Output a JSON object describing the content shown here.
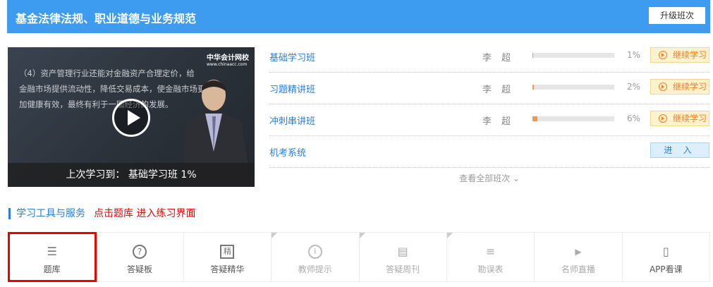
{
  "header": {
    "title": "基金法律法规、职业道德与业务规范",
    "upgrade_label": "升级班次"
  },
  "video": {
    "slide_lines": [
      "（4）资产管理行业还能对金融资产合理定价，给",
      "金融市场提供流动性，降低交易成本，使金融市场更",
      "加健康有效，最终有利于一国经济的发展。"
    ],
    "logo_text": "中华会计网校",
    "logo_url_text": "www.chinaacc.com",
    "last_study": "上次学习到： 基础学习班 1%"
  },
  "classes": [
    {
      "name": "基础学习班",
      "teacher": "李超",
      "progress": 1,
      "progress_label": "1%",
      "action": "继续学习"
    },
    {
      "name": "习题精讲班",
      "teacher": "李超",
      "progress": 2,
      "progress_label": "2%",
      "action": "继续学习"
    },
    {
      "name": "冲刺串讲班",
      "teacher": "李超",
      "progress": 6,
      "progress_label": "6%",
      "action": "继续学习"
    }
  ],
  "exam_system": {
    "name": "机考系统",
    "action": "进 入"
  },
  "view_all": "查看全部班次 ⌄",
  "section": {
    "title": "学习工具与服务",
    "hint": "点击题库  进入练习界面"
  },
  "tools": [
    {
      "label": "题库",
      "icon": "☰"
    },
    {
      "label": "答疑板",
      "icon": "?"
    },
    {
      "label": "答疑精华",
      "icon": "精"
    },
    {
      "label": "教师提示",
      "icon": "i"
    },
    {
      "label": "答疑周刊",
      "icon": "▤"
    },
    {
      "label": "勘误表",
      "icon": "≡"
    },
    {
      "label": "名师直播",
      "icon": "▶"
    },
    {
      "label": "APP看课",
      "icon": "▯"
    }
  ],
  "colors": {
    "brand": "#3d9cf0",
    "accent": "#f47b20",
    "highlight": "#ee0000"
  }
}
